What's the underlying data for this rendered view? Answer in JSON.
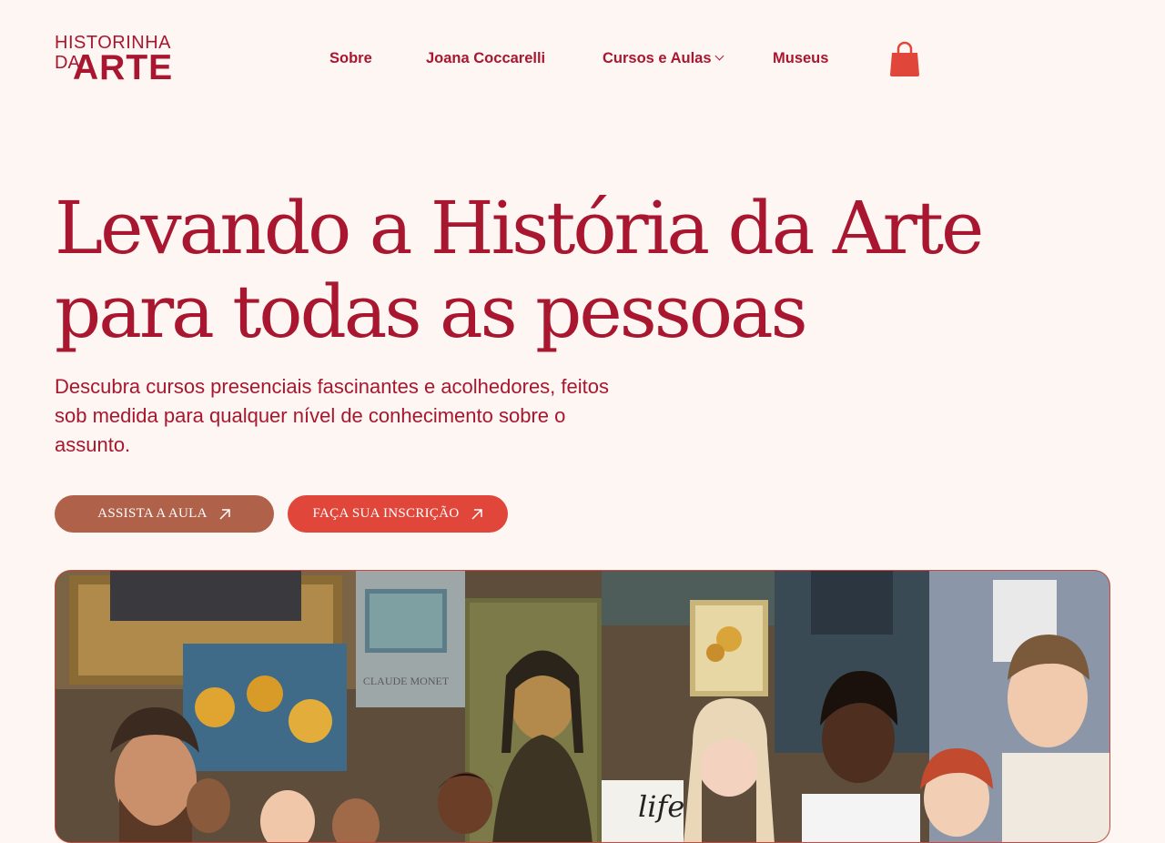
{
  "logo": {
    "line1": "HISTORINHA",
    "line2_small": "DA",
    "line2_big": "ARTE"
  },
  "nav": {
    "items": [
      {
        "label": "Sobre"
      },
      {
        "label": "Joana Coccarelli"
      },
      {
        "label": "Cursos e Aulas"
      },
      {
        "label": "Museus"
      }
    ]
  },
  "hero": {
    "title_line1": "Levando a História da Arte",
    "title_line2": "para todas as pessoas",
    "subtitle": "Descubra cursos presenciais fascinantes e acolhedores, feitos sob medida para qualquer nível de conhecimento sobre o assunto.",
    "buttons": {
      "watch_label": "ASSISTA A AULA",
      "enroll_label": "FAÇA SUA INSCRIÇÃO"
    },
    "image": {
      "painting_label": "CLAUDE MONET",
      "sign_text": "life"
    }
  },
  "colors": {
    "background": "#fdf6f2",
    "brand": "#a8172f",
    "button_watch": "#b0614a",
    "button_enroll": "#e0473a",
    "cart": "#e0473a"
  },
  "icons": {
    "cart": "shopping-bag-icon",
    "dropdown": "chevron-down-icon",
    "arrow": "arrow-up-right-icon"
  }
}
